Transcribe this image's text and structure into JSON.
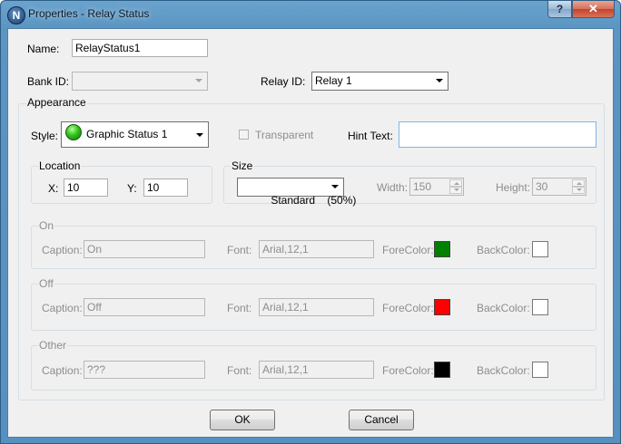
{
  "window": {
    "title": "Properties - Relay Status",
    "icon_letter": "N",
    "help_label": "?",
    "close_label": "✕"
  },
  "form": {
    "name_label": "Name:",
    "name_value": "RelayStatus1",
    "bank_label": "Bank ID:",
    "bank_value": "",
    "relay_label": "Relay ID:",
    "relay_value": "Relay 1"
  },
  "appearance": {
    "title": "Appearance",
    "style_label": "Style:",
    "style_value": "Graphic Status 1",
    "style_icon": "green-led-icon",
    "transparent_label": "Transparent",
    "hint_label": "Hint Text:",
    "hint_value": "",
    "location": {
      "title": "Location",
      "x_label": "X:",
      "x_value": "10",
      "y_label": "Y:",
      "y_value": "10"
    },
    "size": {
      "title": "Size",
      "preset_value": "Standard    (50%)",
      "width_label": "Width:",
      "width_value": "150",
      "height_label": "Height:",
      "height_value": "30"
    }
  },
  "states": [
    {
      "title": "On",
      "caption_label": "Caption:",
      "caption_value": "On",
      "font_label": "Font:",
      "font_value": "Arial,12,1",
      "fore_label": "ForeColor:",
      "fore_color": "#008000",
      "back_label": "BackColor:",
      "back_color": "#ffffff"
    },
    {
      "title": "Off",
      "caption_label": "Caption:",
      "caption_value": "Off",
      "font_label": "Font:",
      "font_value": "Arial,12,1",
      "fore_label": "ForeColor:",
      "fore_color": "#ff0000",
      "back_label": "BackColor:",
      "back_color": "#ffffff"
    },
    {
      "title": "Other",
      "caption_label": "Caption:",
      "caption_value": "???",
      "font_label": "Font:",
      "font_value": "Arial,12,1",
      "fore_label": "ForeColor:",
      "fore_color": "#000000",
      "back_label": "BackColor:",
      "back_color": "#ffffff"
    }
  ],
  "buttons": {
    "ok_label": "OK",
    "cancel_label": "Cancel"
  }
}
